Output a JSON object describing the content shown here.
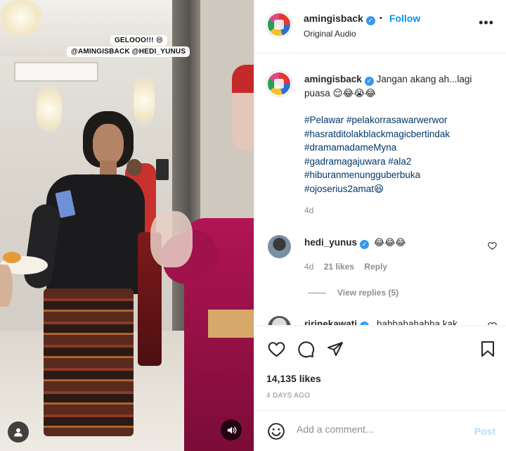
{
  "media": {
    "caption_line1": "GELOOO!!! 😄",
    "caption_line2": "@AMINGISBACK  @HEDI_YUNUS"
  },
  "header": {
    "username": "amingisback",
    "dot": "•",
    "follow_label": "Follow",
    "audio_label": "Original Audio",
    "more_label": "•••"
  },
  "caption": {
    "username": "amingisback",
    "text": "Jangan akang ah...lagi puasa 😌😂😭😂",
    "hashtags": [
      "#Pelawar #pelakorrasawarwerwor",
      "#hasratditolakblackmagicbertindak",
      "#dramamadameMyna",
      "#gadramagajuwara #ala2",
      "#hiburanmenungguberbuka",
      "#ojoserius2amat😆"
    ],
    "age": "4d"
  },
  "comments": [
    {
      "username": "hedi_yunus",
      "text": "😂😂😂",
      "age": "4d",
      "likes": "21 likes",
      "reply_label": "Reply",
      "view_replies": "View replies (5)"
    },
    {
      "username": "ririnekawati",
      "text": "hahhahahahha kak"
    }
  ],
  "post": {
    "likes": "14,135 likes",
    "date": "4 DAYS AGO"
  },
  "comment_box": {
    "placeholder": "Add a comment...",
    "post_label": "Post"
  },
  "icons": {
    "like": "heart-icon",
    "comment": "comment-icon",
    "share": "share-icon",
    "save": "bookmark-icon",
    "emoji": "emoji-icon",
    "user": "user-tag-icon",
    "sound": "sound-icon"
  },
  "colors": {
    "accent": "#0095f6",
    "verified": "#3897f0",
    "post_disabled": "#b2dffc"
  }
}
